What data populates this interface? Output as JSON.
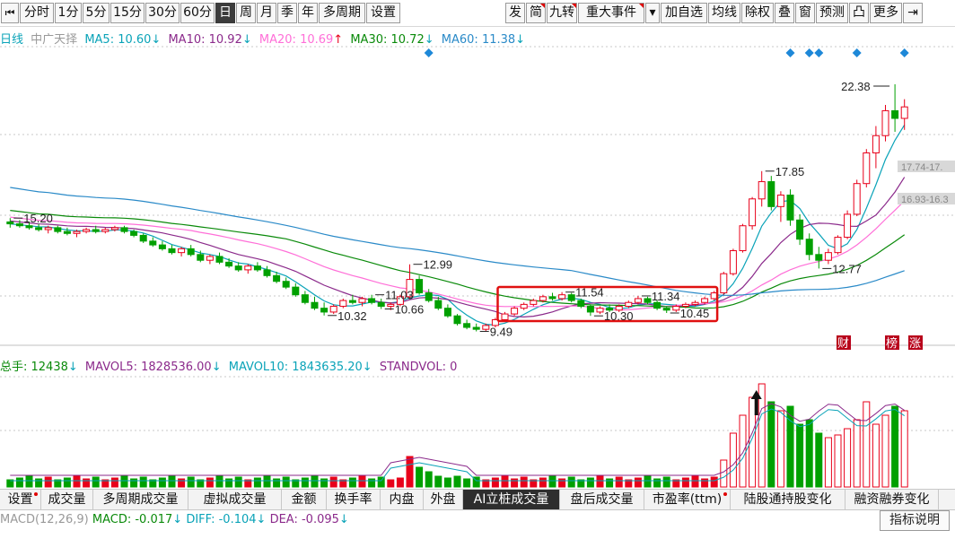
{
  "toolbar": {
    "left_buttons": [
      {
        "label": "分时",
        "active": false
      },
      {
        "label": "1分",
        "active": false
      },
      {
        "label": "5分",
        "active": false
      },
      {
        "label": "15分",
        "active": false
      },
      {
        "label": "30分",
        "active": false
      },
      {
        "label": "60分",
        "active": false
      },
      {
        "label": "日",
        "active": true
      },
      {
        "label": "周",
        "active": false
      },
      {
        "label": "月",
        "active": false
      },
      {
        "label": "季",
        "active": false
      },
      {
        "label": "年",
        "active": false
      },
      {
        "label": "多周期",
        "active": false
      },
      {
        "label": "设置",
        "active": false
      }
    ],
    "right_buttons": [
      {
        "label": "发"
      },
      {
        "label": "简"
      },
      {
        "label": "九转"
      },
      {
        "label": "重大事件"
      },
      {
        "label": "▾"
      },
      {
        "label": "加自选"
      },
      {
        "label": "均线"
      },
      {
        "label": "除权"
      },
      {
        "label": "叠"
      },
      {
        "label": "窗"
      },
      {
        "label": "预测"
      },
      {
        "label": "凸"
      },
      {
        "label": "更多"
      },
      {
        "label": "⇥"
      }
    ],
    "nav_left_icon": "first-page-icon"
  },
  "price_legend": {
    "period": "日线",
    "name": "中广天择",
    "ma5": "MA5: 10.60",
    "ma10": "MA10: 10.92",
    "ma20": "MA20: 10.69",
    "ma30": "MA30: 10.72",
    "ma60": "MA60: 11.38",
    "ma5_dir": "↓",
    "ma10_dir": "↓",
    "ma20_dir": "↑",
    "ma30_dir": "↓",
    "ma60_dir": "↓"
  },
  "volume_legend": {
    "total": "总手: 12438",
    "mavol5": "MAVOL5: 1828536.00",
    "mavol10": "MAVOL10: 1843635.20",
    "stand_vol": "STANDVOL: 0",
    "total_dir": "↓",
    "mavol5_dir": "↓",
    "mavol10_dir": "↓"
  },
  "price_annotations": [
    "15.20",
    "10.32",
    "11.03",
    "10.66",
    "12.99",
    "9.49",
    "11.54",
    "10.30",
    "11.34",
    "10.45",
    "17.85",
    "12.77",
    "22.38"
  ],
  "right_labels": [
    "17.74-17.",
    "16.93-16.3"
  ],
  "event_markers": [
    "财",
    "榜",
    "涨"
  ],
  "tabs": [
    {
      "label": "设置",
      "dot": true
    },
    {
      "label": "成交量"
    },
    {
      "label": "多周期成交量"
    },
    {
      "label": "虚拟成交量"
    },
    {
      "label": "金额"
    },
    {
      "label": "换手率"
    },
    {
      "label": "内盘"
    },
    {
      "label": "外盘"
    },
    {
      "label": "AI立桩成交量",
      "active": true
    },
    {
      "label": "盘后成交量"
    },
    {
      "label": "市盈率(ttm)",
      "dot": true
    },
    {
      "label": "陆股通持股变化"
    },
    {
      "label": "融资融券变化"
    }
  ],
  "macd": {
    "params": "MACD(12,26,9)",
    "macd": "MACD: -0.017",
    "diff": "DIFF: -0.104",
    "dea": "DEA: -0.095"
  },
  "help_button": "指标说明",
  "colors": {
    "up": "#e8001a",
    "down": "#00a000",
    "ma5": "#0aa3b8",
    "ma10": "#8b2a8b",
    "ma20": "#ff6fd8",
    "ma30": "#0a8a0a",
    "ma60": "#2a8ac8",
    "highlight_box": "#e01010"
  },
  "chart_data": {
    "type": "candlestick",
    "title": "中广天择 日线",
    "ylim": [
      9.0,
      23.5
    ],
    "candles": [
      [
        15.2,
        15.4,
        14.9,
        15.1
      ],
      [
        15.1,
        15.3,
        14.9,
        15.0
      ],
      [
        15.0,
        15.2,
        14.8,
        14.9
      ],
      [
        14.9,
        15.1,
        14.7,
        14.8
      ],
      [
        14.8,
        15.0,
        14.6,
        14.9
      ],
      [
        14.9,
        15.0,
        14.6,
        14.7
      ],
      [
        14.7,
        14.9,
        14.5,
        14.6
      ],
      [
        14.6,
        14.8,
        14.4,
        14.7
      ],
      [
        14.7,
        14.9,
        14.6,
        14.8
      ],
      [
        14.8,
        15.0,
        14.6,
        14.7
      ],
      [
        14.7,
        14.9,
        14.6,
        14.8
      ],
      [
        14.8,
        15.0,
        14.7,
        14.9
      ],
      [
        14.9,
        15.0,
        14.6,
        14.7
      ],
      [
        14.7,
        14.8,
        14.4,
        14.5
      ],
      [
        14.5,
        14.6,
        14.1,
        14.2
      ],
      [
        14.2,
        14.4,
        13.9,
        14.0
      ],
      [
        14.0,
        14.2,
        13.7,
        13.8
      ],
      [
        13.8,
        14.0,
        13.5,
        13.6
      ],
      [
        13.6,
        13.9,
        13.4,
        13.8
      ],
      [
        13.8,
        14.0,
        13.4,
        13.5
      ],
      [
        13.5,
        13.7,
        13.1,
        13.2
      ],
      [
        13.2,
        13.5,
        13.0,
        13.4
      ],
      [
        13.4,
        13.6,
        13.0,
        13.1
      ],
      [
        13.1,
        13.3,
        12.8,
        12.9
      ],
      [
        12.9,
        13.1,
        12.6,
        12.7
      ],
      [
        12.7,
        13.0,
        12.5,
        12.9
      ],
      [
        12.9,
        13.1,
        12.6,
        12.7
      ],
      [
        12.7,
        12.9,
        12.3,
        12.4
      ],
      [
        12.4,
        12.6,
        12.0,
        12.1
      ],
      [
        12.1,
        12.3,
        11.7,
        11.8
      ],
      [
        11.8,
        12.0,
        11.3,
        11.4
      ],
      [
        11.4,
        11.6,
        10.9,
        11.0
      ],
      [
        11.0,
        11.3,
        10.6,
        10.7
      ],
      [
        10.7,
        11.0,
        10.32,
        10.5
      ],
      [
        10.5,
        10.9,
        10.4,
        10.8
      ],
      [
        10.8,
        11.2,
        10.7,
        11.1
      ],
      [
        11.1,
        11.4,
        10.9,
        11.0
      ],
      [
        11.0,
        11.3,
        10.8,
        11.2
      ],
      [
        11.2,
        11.4,
        10.9,
        11.0
      ],
      [
        11.0,
        11.2,
        10.66,
        10.8
      ],
      [
        10.8,
        11.0,
        10.6,
        10.9
      ],
      [
        10.9,
        11.4,
        10.8,
        11.3
      ],
      [
        11.3,
        12.99,
        11.2,
        12.2
      ],
      [
        12.2,
        12.4,
        11.4,
        11.5
      ],
      [
        11.5,
        11.7,
        11.0,
        11.1
      ],
      [
        11.1,
        11.3,
        10.6,
        10.7
      ],
      [
        10.7,
        10.9,
        10.2,
        10.3
      ],
      [
        10.3,
        10.4,
        9.8,
        9.9
      ],
      [
        9.9,
        10.1,
        9.6,
        9.7
      ],
      [
        9.7,
        9.9,
        9.49,
        9.6
      ],
      [
        9.6,
        9.9,
        9.5,
        9.8
      ],
      [
        9.8,
        10.2,
        9.7,
        10.1
      ],
      [
        10.1,
        10.5,
        10.0,
        10.4
      ],
      [
        10.4,
        10.8,
        10.3,
        10.7
      ],
      [
        10.7,
        11.0,
        10.6,
        10.9
      ],
      [
        10.9,
        11.2,
        10.8,
        11.1
      ],
      [
        11.1,
        11.4,
        11.0,
        11.3
      ],
      [
        11.3,
        11.5,
        11.1,
        11.2
      ],
      [
        11.2,
        11.54,
        11.1,
        11.4
      ],
      [
        11.4,
        11.5,
        11.0,
        11.1
      ],
      [
        11.1,
        11.2,
        10.7,
        10.8
      ],
      [
        10.8,
        10.9,
        10.3,
        10.5
      ],
      [
        10.5,
        10.8,
        10.4,
        10.7
      ],
      [
        10.7,
        10.9,
        10.5,
        10.6
      ],
      [
        10.6,
        10.9,
        10.5,
        10.8
      ],
      [
        10.8,
        11.1,
        10.7,
        11.0
      ],
      [
        11.0,
        11.34,
        10.9,
        11.2
      ],
      [
        11.2,
        11.3,
        10.9,
        11.0
      ],
      [
        11.0,
        11.1,
        10.6,
        10.7
      ],
      [
        10.7,
        10.8,
        10.45,
        10.6
      ],
      [
        10.6,
        10.9,
        10.5,
        10.8
      ],
      [
        10.8,
        11.0,
        10.7,
        10.9
      ],
      [
        10.9,
        11.1,
        10.8,
        11.0
      ],
      [
        11.0,
        11.3,
        10.9,
        11.2
      ],
      [
        11.2,
        11.6,
        11.1,
        11.5
      ],
      [
        11.5,
        12.6,
        11.4,
        12.5
      ],
      [
        12.5,
        13.8,
        12.4,
        13.7
      ],
      [
        13.7,
        15.1,
        13.6,
        15.0
      ],
      [
        15.0,
        16.5,
        14.8,
        16.4
      ],
      [
        16.4,
        17.85,
        16.0,
        17.3
      ],
      [
        17.3,
        17.6,
        15.8,
        16.0
      ],
      [
        16.0,
        16.8,
        15.2,
        16.6
      ],
      [
        16.6,
        16.9,
        15.0,
        15.3
      ],
      [
        15.3,
        15.6,
        14.0,
        14.3
      ],
      [
        14.3,
        14.6,
        13.2,
        13.5
      ],
      [
        13.5,
        13.9,
        12.77,
        13.2
      ],
      [
        13.2,
        13.8,
        13.0,
        13.6
      ],
      [
        13.6,
        14.5,
        13.5,
        14.4
      ],
      [
        14.4,
        15.8,
        14.3,
        15.6
      ],
      [
        15.6,
        17.4,
        15.5,
        17.2
      ],
      [
        17.2,
        19.0,
        17.0,
        18.8
      ],
      [
        18.8,
        20.2,
        18.0,
        19.7
      ],
      [
        19.7,
        21.3,
        19.4,
        21.0
      ],
      [
        21.0,
        22.38,
        19.9,
        20.6
      ],
      [
        20.6,
        21.6,
        20.0,
        21.2
      ]
    ],
    "highlight_range": [
      52,
      73
    ]
  }
}
